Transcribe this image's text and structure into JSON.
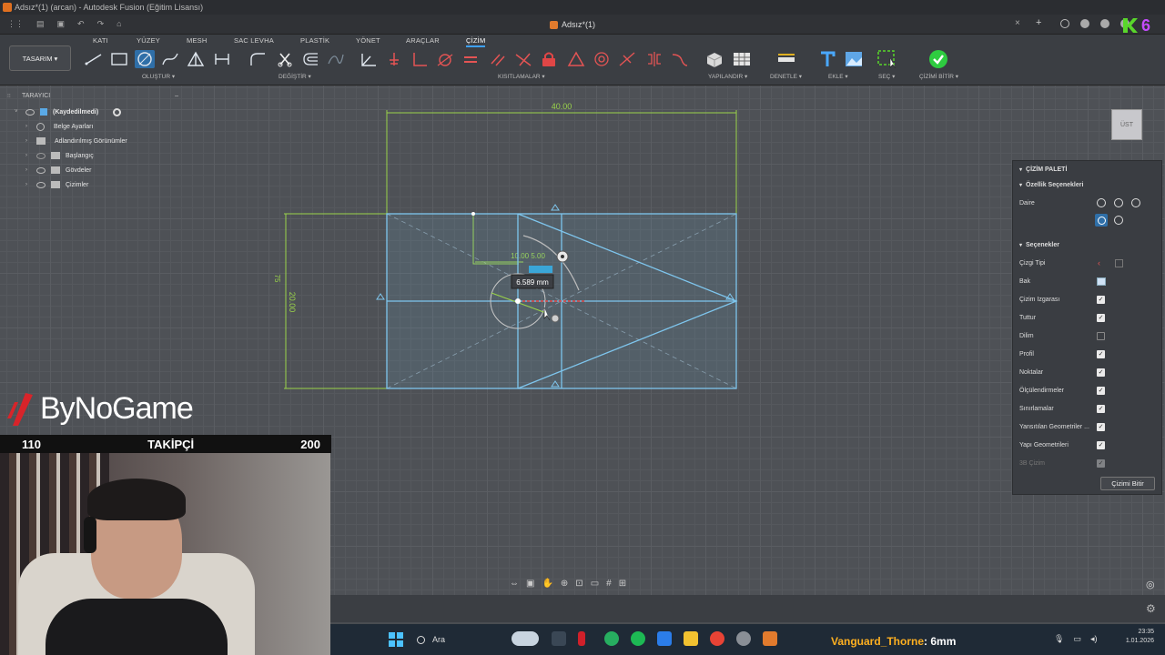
{
  "window": {
    "title": "Adsız*(1) (arcan) - Autodesk Fusion (Eğitim Lisansı)",
    "doc_tab": "Adsız*(1)"
  },
  "ribbon": {
    "workspace": "TASARIM ▾",
    "tabs": [
      "KATI",
      "YÜZEY",
      "MESH",
      "SAC LEVHA",
      "PLASTİK",
      "YÖNET",
      "ARAÇLAR",
      "ÇİZİM"
    ],
    "active_tab": "ÇİZİM",
    "groups": {
      "create": "OLUŞTUR ▾",
      "modify": "DEĞİŞTİR ▾",
      "constraints": "KISITLAMALAR ▾",
      "configure": "YAPILANDIR ▾",
      "inspect": "DENETLE ▾",
      "insert": "EKLE ▾",
      "select": "SEÇ ▾",
      "finish": "ÇİZİMİ BİTİR ▾"
    }
  },
  "browser": {
    "header": "TARAYICI",
    "items": [
      {
        "label": "(Kaydedilmedi)"
      },
      {
        "label": "Belge Ayarları"
      },
      {
        "label": "Adlandırılmış Görünümler"
      },
      {
        "label": "Başlangıç"
      },
      {
        "label": "Gövdeler"
      },
      {
        "label": "Çizimler"
      }
    ]
  },
  "sketch": {
    "dim_width": "40.00",
    "dim_left": "20.00",
    "dim_outer": "75",
    "dim_radius": "10.00 5.00",
    "input_value": "6.589 mm"
  },
  "viewcube": {
    "label": "ÜST"
  },
  "palette": {
    "title": "ÇİZİM PALETİ",
    "section1": "Özellik Seçenekleri",
    "circle_label": "Daire",
    "section2": "Seçenekler",
    "options": [
      {
        "label": "Çizgi Tipi",
        "state": "icon"
      },
      {
        "label": "Bak",
        "state": "icon"
      },
      {
        "label": "Çizim Izgarası",
        "state": "on"
      },
      {
        "label": "Tuttur",
        "state": "on"
      },
      {
        "label": "Dilim",
        "state": "off"
      },
      {
        "label": "Profil",
        "state": "on"
      },
      {
        "label": "Noktalar",
        "state": "on"
      },
      {
        "label": "Ölçülendirmeler",
        "state": "on"
      },
      {
        "label": "Sınırlamalar",
        "state": "on"
      },
      {
        "label": "Yansıtılan Geometriler ...",
        "state": "on"
      },
      {
        "label": "Yapı Geometrileri",
        "state": "on"
      },
      {
        "label": "3B Çizim",
        "state": "dim"
      }
    ],
    "finish_button": "Çizimi Bitir"
  },
  "stream": {
    "logo": "ByNoGame",
    "followers_current": "110",
    "followers_label": "TAKİPÇİ",
    "followers_goal": "200",
    "corner_badge": "6",
    "chat_user": "Vanguard_Thorne",
    "chat_message": ": 6mm"
  },
  "taskbar": {
    "search": "Ara",
    "time": "23:35",
    "date": "1.01.2026"
  },
  "colors": {
    "accent": "#3ea1ff",
    "sketch_line": "#7fc6ee",
    "dimension": "#9ad34a",
    "constraint_red": "#e04646",
    "finish_green": "#2ecc40"
  }
}
